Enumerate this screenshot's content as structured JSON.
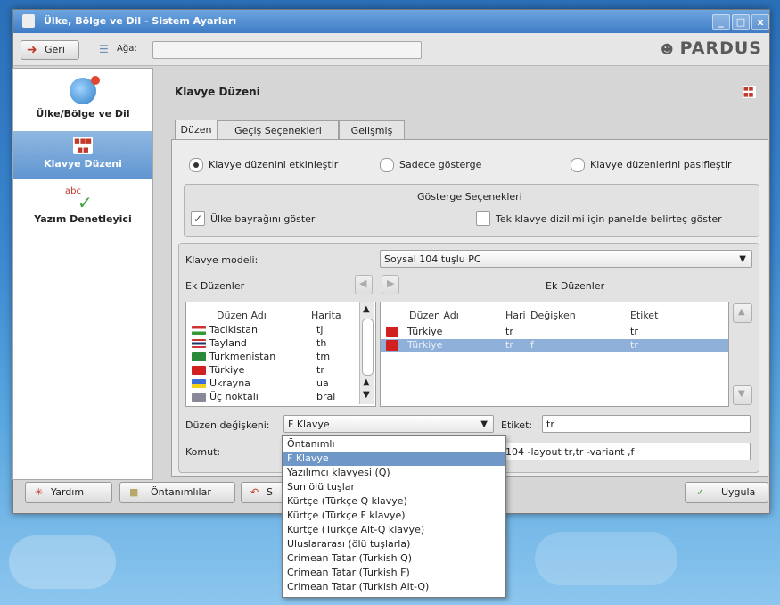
{
  "window": {
    "title": "Ülke, Bölge ve Dil - Sistem Ayarları",
    "min": "_",
    "max": "□",
    "close": "x"
  },
  "toolbar": {
    "back": "Geri",
    "tree": "Ağa:",
    "logo": "PARDUS"
  },
  "sidebar": {
    "items": [
      {
        "label": "Ülke/Bölge ve Dil",
        "icon": "globe-icon"
      },
      {
        "label": "Klavye Düzeni",
        "icon": "keyboard-icon"
      },
      {
        "label": "Yazım Denetleyici",
        "icon": "spellcheck-icon"
      }
    ]
  },
  "page": {
    "title": "Klavye Düzeni"
  },
  "tabs": [
    {
      "label": "Düzen"
    },
    {
      "label": "Geçiş Seçenekleri"
    },
    {
      "label": "Gelişmiş"
    }
  ],
  "radios": [
    {
      "label": "Klavye düzenini etkinleştir",
      "checked": true
    },
    {
      "label": "Sadece gösterge",
      "checked": false
    },
    {
      "label": "Klavye düzenlerini pasifleştir",
      "checked": false
    }
  ],
  "indicator": {
    "title": "Gösterge Seçenekleri",
    "flag": "Ülke bayrağını göster",
    "panel": "Tek klavye dizilimi için panelde belirteç göster"
  },
  "model": {
    "label": "Klavye modeli:",
    "value": "Soysal 104 tuşlu PC"
  },
  "extra": {
    "left_label": "Ek Düzenler",
    "right_label": "Ek Düzenler"
  },
  "available": {
    "headers": [
      "Düzen Adı",
      "Harita"
    ],
    "rows": [
      {
        "flag": "tj",
        "name": "Tacikistan",
        "map": "tj"
      },
      {
        "flag": "th",
        "name": "Tayland",
        "map": "th"
      },
      {
        "flag": "tm",
        "name": "Turkmenistan",
        "map": "tm"
      },
      {
        "flag": "tr",
        "name": "Türkiye",
        "map": "tr"
      },
      {
        "flag": "ua",
        "name": "Ukrayna",
        "map": "ua"
      },
      {
        "flag": "braille",
        "name": "Üç noktalı",
        "map": "brai"
      }
    ]
  },
  "active": {
    "headers": [
      "Düzen Adı",
      "Hari",
      "Değişken",
      "Etiket"
    ],
    "rows": [
      {
        "flag": "tr",
        "name": "Türkiye",
        "map": "tr",
        "variant": "",
        "label": "tr"
      },
      {
        "flag": "tr",
        "name": "Türkiye",
        "map": "tr",
        "variant": "f",
        "label": "tr"
      }
    ]
  },
  "variant": {
    "label": "Düzen değişkeni:",
    "value": "F Klavye",
    "tag_label": "Etiket:",
    "tag": "tr"
  },
  "command": {
    "label": "Komut:",
    "value": "104 -layout tr,tr -variant ,f"
  },
  "variant_menu": [
    "Öntanımlı",
    "F Klavye",
    "Yazılımcı klavyesi (Q)",
    "Sun ölü tuşlar",
    "Kürtçe (Türkçe Q klavye)",
    "Kürtçe (Türkçe F klavye)",
    "Kürtçe (Türkçe Alt-Q klavye)",
    "Uluslararası (ölü tuşlarla)",
    "Crimean Tatar (Turkish Q)",
    "Crimean Tatar (Turkish F)",
    "Crimean Tatar (Turkish Alt-Q)"
  ],
  "bottom": {
    "help": "Yardım",
    "defaults": "Öntanımlılar",
    "reset": "S",
    "apply": "Uygula"
  },
  "colors": {
    "selection": "#6f98c8",
    "titlebar": "#3f7cc6"
  }
}
